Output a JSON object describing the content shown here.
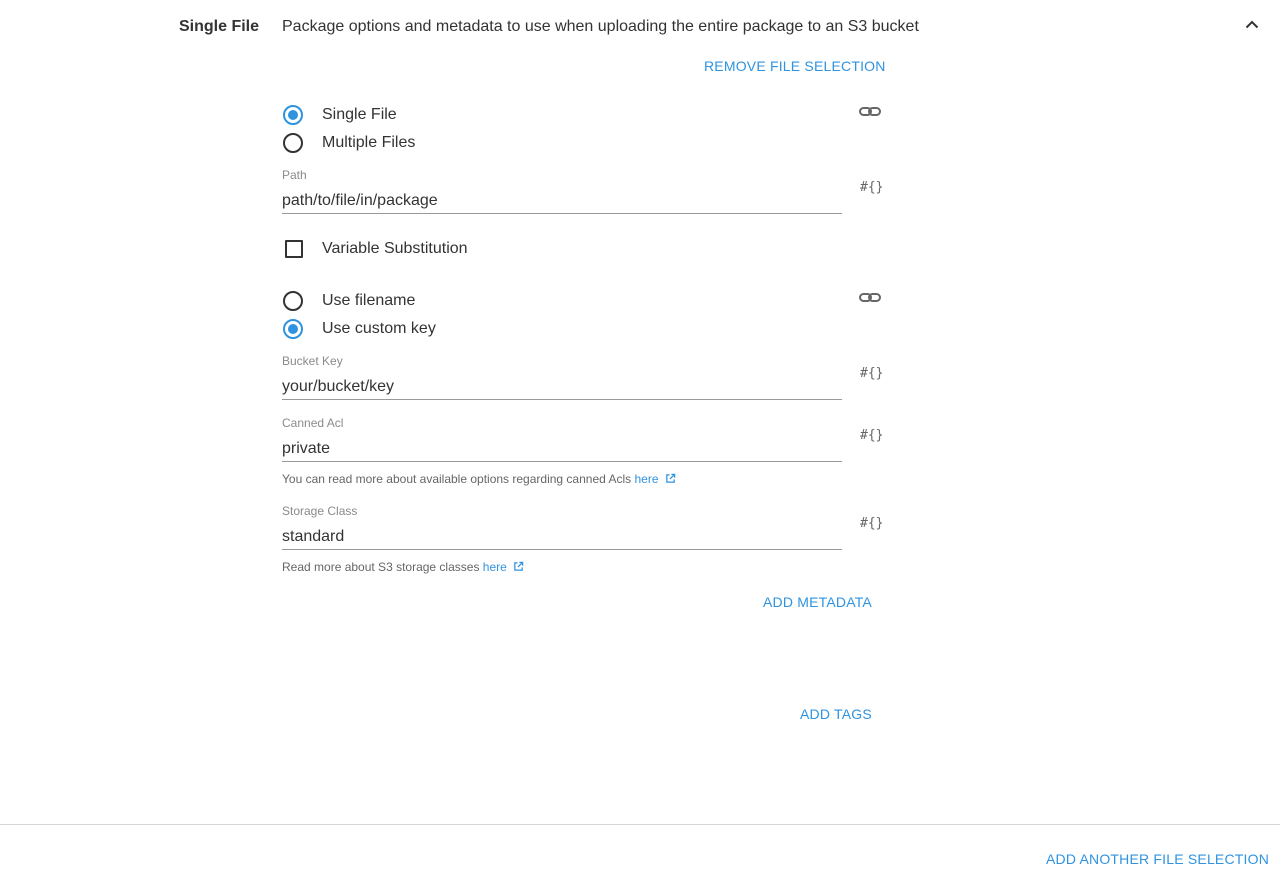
{
  "section": {
    "title": "Single File",
    "description": "Package options and metadata to use when uploading the entire package to an S3 bucket",
    "collapse_icon": "chevron-up-icon"
  },
  "actions": {
    "remove_file_selection": "REMOVE FILE SELECTION",
    "add_metadata": "ADD METADATA",
    "add_tags": "ADD TAGS",
    "add_another_file_selection": "ADD ANOTHER FILE SELECTION"
  },
  "file_mode": {
    "options": [
      {
        "label": "Single File",
        "checked": true
      },
      {
        "label": "Multiple Files",
        "checked": false
      }
    ],
    "binding_icon": "link-icon"
  },
  "path": {
    "label": "Path",
    "value": "path/to/file/in/package",
    "binding_icon_text": "#{}"
  },
  "variable_substitution": {
    "label": "Variable Substitution",
    "checked": false
  },
  "key_mode": {
    "options": [
      {
        "label": "Use filename",
        "checked": false
      },
      {
        "label": "Use custom key",
        "checked": true
      }
    ],
    "binding_icon": "link-icon"
  },
  "bucket_key": {
    "label": "Bucket Key",
    "value": "your/bucket/key",
    "binding_icon_text": "#{}"
  },
  "canned_acl": {
    "label": "Canned Acl",
    "value": "private",
    "binding_icon_text": "#{}",
    "hint_text": "You can read more about available options regarding canned Acls ",
    "hint_link": "here"
  },
  "storage_class": {
    "label": "Storage Class",
    "value": "standard",
    "binding_icon_text": "#{}",
    "hint_text": "Read more about S3 storage classes ",
    "hint_link": "here"
  },
  "colors": {
    "accent": "#2f93e0",
    "text": "#333333",
    "muted": "#8a8a8a",
    "divider": "#d6d6d6"
  }
}
